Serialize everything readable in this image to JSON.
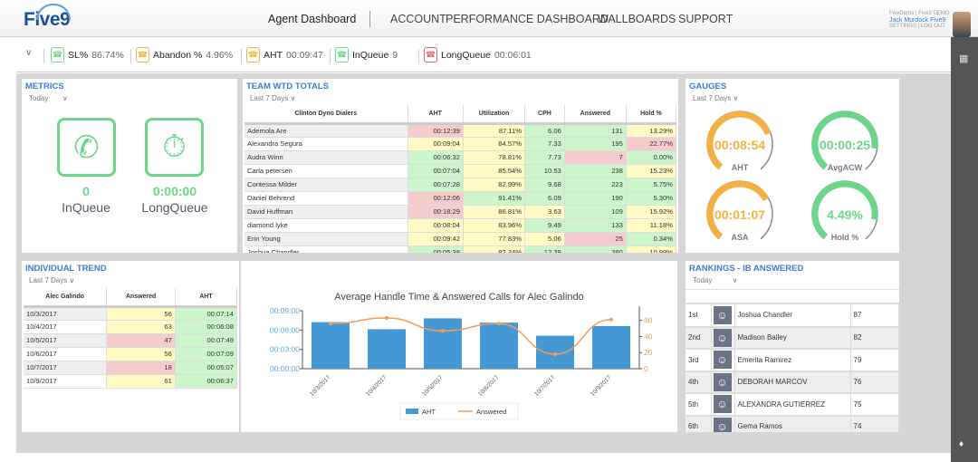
{
  "header": {
    "logo": "Five9",
    "nav": [
      "Agent Dashboard",
      "ACCOUNT",
      "PERFORMANCE DASHBOARD",
      "WALLBOARDS",
      "SUPPORT"
    ],
    "user_line1": "FiveDemo | Five9 DEMO",
    "user_name": "Jack Murdock Five9",
    "user_links": "SETTINGS | LOG OUT"
  },
  "kpis": [
    {
      "label": "SL%",
      "value": "86.74%",
      "color": "#6bd68a"
    },
    {
      "label": "Abandon %",
      "value": "4.96%",
      "color": "#f5b041"
    },
    {
      "label": "AHT",
      "value": "00:09:47",
      "color": "#f5b041"
    },
    {
      "label": "InQueue",
      "value": "9",
      "color": "#6bd68a"
    },
    {
      "label": "LongQueue",
      "value": "00:06:01",
      "color": "#e06666"
    }
  ],
  "metrics": {
    "title": "METRICS",
    "range": "Today",
    "items": [
      {
        "value": "0",
        "label": "InQueue"
      },
      {
        "value": "0:00:00",
        "label": "LongQueue"
      }
    ]
  },
  "team": {
    "title": "TEAM WTD TOTALS",
    "range": "Last 7 Days",
    "columns": [
      "Clinton Dyno Dialers",
      "AHT",
      "Utilization",
      "CPH",
      "Answered",
      "Hold %"
    ],
    "rows": [
      [
        "Ademola Are",
        "00:12:39",
        "87.11%",
        "6.06",
        "131",
        "13.29%"
      ],
      [
        "Alexandra Segura",
        "00:09:04",
        "84.57%",
        "7.33",
        "195",
        "22.77%"
      ],
      [
        "Audra Winn",
        "00:06:32",
        "78.81%",
        "7.73",
        "7",
        "0.00%"
      ],
      [
        "Carla petersen",
        "00:07:04",
        "85.54%",
        "10.53",
        "238",
        "15.23%"
      ],
      [
        "Contessa Milder",
        "00:07:28",
        "82.99%",
        "9.68",
        "223",
        "5.75%"
      ],
      [
        "Daniel Behrend",
        "00:12:06",
        "91.41%",
        "6.09",
        "190",
        "5.30%"
      ],
      [
        "David Huffman",
        "00:18:29",
        "86.81%",
        "3.63",
        "109",
        "15.92%"
      ],
      [
        "diamond lyke",
        "00:08:04",
        "83.96%",
        "9.49",
        "133",
        "11.18%"
      ],
      [
        "Erin Young",
        "00:09:42",
        "77.83%",
        "5.06",
        "25",
        "0.34%"
      ],
      [
        "Joshua Chandler",
        "00:05:38",
        "82.34%",
        "12.39",
        "380",
        "10.99%"
      ]
    ],
    "status": [
      [
        "r",
        "y",
        "g",
        "g",
        "y"
      ],
      [
        "y",
        "y",
        "g",
        "g",
        "r"
      ],
      [
        "g",
        "y",
        "g",
        "r",
        "g"
      ],
      [
        "g",
        "y",
        "g",
        "g",
        "y"
      ],
      [
        "g",
        "y",
        "g",
        "g",
        "g"
      ],
      [
        "r",
        "g",
        "g",
        "g",
        "g"
      ],
      [
        "r",
        "y",
        "y",
        "g",
        "y"
      ],
      [
        "y",
        "y",
        "g",
        "g",
        "y"
      ],
      [
        "y",
        "y",
        "y",
        "r",
        "g"
      ],
      [
        "g",
        "y",
        "g",
        "g",
        "y"
      ]
    ]
  },
  "gauges": {
    "title": "GAUGES",
    "range": "Last 7 Days",
    "items": [
      {
        "value": "00:08:54",
        "label": "AHT",
        "color": "#f5b041",
        "fill": 0.75
      },
      {
        "value": "00:00:25",
        "label": "AvgACW",
        "color": "#6bd68a",
        "fill": 0.85
      },
      {
        "value": "00:01:07",
        "label": "ASA",
        "color": "#f5b041",
        "fill": 0.72
      },
      {
        "value": "4.49%",
        "label": "Hold %",
        "color": "#6bd68a",
        "fill": 0.86
      }
    ]
  },
  "trend": {
    "title": "INDIVIDUAL TREND",
    "range": "Last 7 Days",
    "columns": [
      "Alec Galindo",
      "Answered",
      "AHT"
    ],
    "rows": [
      [
        "10/3/2017",
        "56",
        "00:07:14"
      ],
      [
        "10/4/2017",
        "63",
        "00:06:08"
      ],
      [
        "10/5/2017",
        "47",
        "00:07:49"
      ],
      [
        "10/6/2017",
        "56",
        "00:07:09"
      ],
      [
        "10/7/2017",
        "18",
        "00:05:07"
      ],
      [
        "10/9/2017",
        "61",
        "00:06:37"
      ]
    ],
    "status": [
      [
        "y",
        "g"
      ],
      [
        "y",
        "g"
      ],
      [
        "r",
        "g"
      ],
      [
        "y",
        "g"
      ],
      [
        "r",
        "g"
      ],
      [
        "y",
        "g"
      ]
    ]
  },
  "chart_data": {
    "type": "bar",
    "title": "Average Handle Time & Answered Calls for Alec Galindo",
    "categories": [
      "10/3/2017",
      "10/4/2017",
      "10/5/2017",
      "10/6/2017",
      "10/7/2017",
      "10/9/2017"
    ],
    "series": [
      {
        "name": "AHT",
        "type": "bar",
        "axis": "left",
        "values_seconds": [
          434,
          368,
          469,
          429,
          307,
          397
        ],
        "color": "#4499d4"
      },
      {
        "name": "Answered",
        "type": "line",
        "axis": "right",
        "values": [
          56,
          63,
          47,
          56,
          18,
          61
        ],
        "color": "#f39c5a"
      }
    ],
    "left_ticks": [
      "00:00:00",
      "00:03:00",
      "00:06:00",
      "00:09:00"
    ],
    "ylim_left_seconds": [
      0,
      540
    ],
    "right_ticks": [
      "0",
      "20",
      "40",
      "60"
    ],
    "ylim_right": [
      0,
      72
    ],
    "legend": "bottom"
  },
  "rankings": {
    "title": "RANKINGS - IB ANSWERED",
    "range": "Today",
    "rows": [
      [
        "1st",
        "Joshua Chandler",
        "87"
      ],
      [
        "2nd",
        "Madison Bailey",
        "82"
      ],
      [
        "3rd",
        "Emerita Ramirez",
        "79"
      ],
      [
        "4th",
        "DEBORAH MARCOV",
        "76"
      ],
      [
        "5th",
        "ALEXANDRA GUTIERREZ",
        "75"
      ],
      [
        "6th",
        "Gema Ramos",
        "74"
      ]
    ]
  }
}
